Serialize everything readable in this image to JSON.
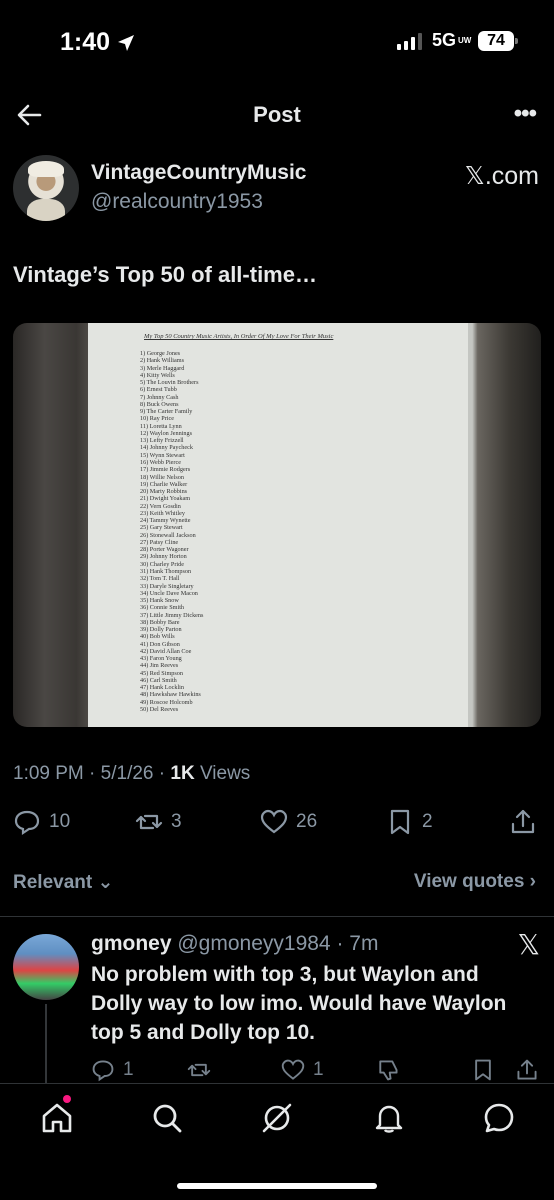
{
  "status_bar": {
    "time": "1:40",
    "network": "5G",
    "network_sub": "UW",
    "battery": "74"
  },
  "header": {
    "title": "Post"
  },
  "author": {
    "name": "VintageCountryMusic",
    "handle": "@realcountry1953",
    "source": "𝕏.com"
  },
  "post": {
    "text": "Vintage’s Top 50 of all-time…"
  },
  "photo": {
    "title": "My Top 50 Country Music Artists, In Order Of My Love For Their Music",
    "items": [
      "1) George Jones",
      "2) Hank Williams",
      "3) Merle Haggard",
      "4) Kitty Wells",
      "5) The Louvin Brothers",
      "6) Ernest Tubb",
      "7) Johnny Cash",
      "8) Buck Owens",
      "9) The Carter Family",
      "10) Ray Price",
      "11) Loretta Lynn",
      "12) Waylon Jennings",
      "13) Lefty Frizzell",
      "14) Johnny Paycheck",
      "15) Wynn Stewart",
      "16) Webb Pierce",
      "17) Jimmie Rodgers",
      "18) Willie Nelson",
      "19) Charlie Walker",
      "20) Marty Robbins",
      "21) Dwight Yoakam",
      "22) Vern Gosdin",
      "23) Keith Whitley",
      "24) Tammy Wynette",
      "25) Gary Stewart",
      "26) Stonewall Jackson",
      "27) Patsy Cline",
      "28) Porter Wagoner",
      "29) Johnny Horton",
      "30) Charley Pride",
      "31) Hank Thompson",
      "32) Tom T. Hall",
      "33) Daryle Singletary",
      "34) Uncle Dave Macon",
      "35) Hank Snow",
      "36) Connie Smith",
      "37) Little Jimmy Dickens",
      "38) Bobby Bare",
      "39) Dolly Parton",
      "40) Bob Wills",
      "41) Don Gibson",
      "42) David Allan Coe",
      "43) Faron Young",
      "44) Jim Reeves",
      "45) Red Simpson",
      "46) Carl Smith",
      "47) Hank Locklin",
      "48) Hawkshaw Hawkins",
      "49) Roscoe Holcomb",
      "50) Del Reeves"
    ]
  },
  "meta": {
    "time": "1:09 PM",
    "sep": "·",
    "date": "5/1/26",
    "views_count": "1K",
    "views_label": "Views"
  },
  "actions": {
    "replies": "10",
    "reposts": "3",
    "likes": "26",
    "bookmarks": "2"
  },
  "filter": {
    "relevant": "Relevant",
    "view_quotes": "View quotes"
  },
  "reply": {
    "name": "gmoney",
    "handle": "@gmoneyy1984",
    "time": "· 7m",
    "text": "No problem with top 3, but Waylon and Dolly way to low imo.  Would have Waylon top 5 and Dolly top 10.",
    "replies": "1",
    "likes": "1"
  },
  "colors": {
    "background": "#000000",
    "text": "#e7e9ea",
    "muted": "#8b98a5",
    "notification_dot": "#f91880"
  }
}
